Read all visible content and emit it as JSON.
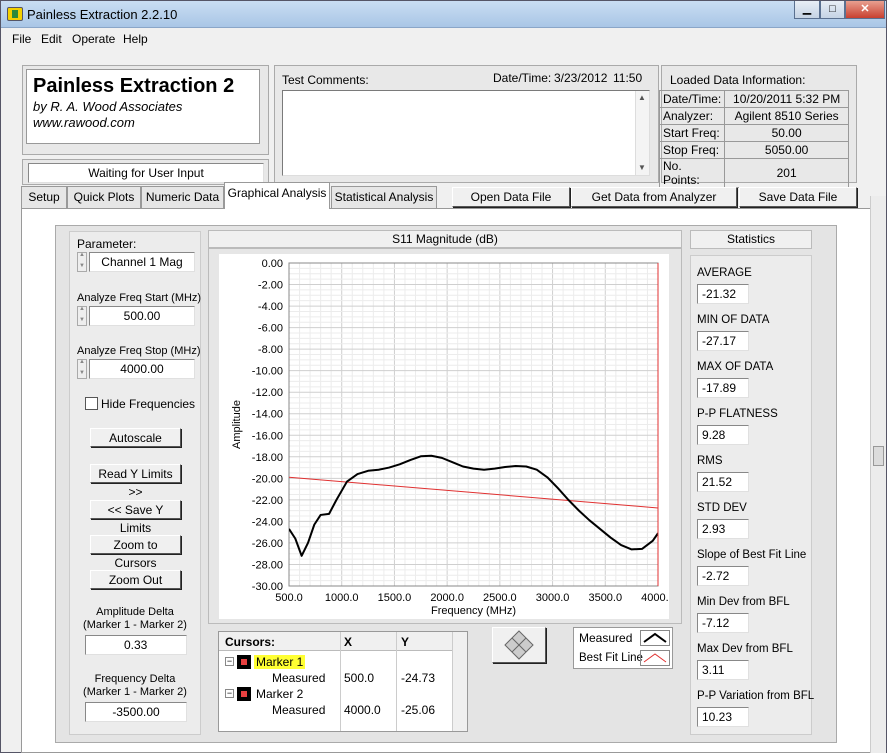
{
  "window": {
    "title": "Painless Extraction 2.2.10"
  },
  "menu": [
    "File",
    "Edit",
    "Operate",
    "Help"
  ],
  "brand": {
    "title": "Painless Extraction 2",
    "author": "by R. A. Wood Associates",
    "url": "www.rawood.com"
  },
  "status": "Waiting for User Input",
  "comments": {
    "label": "Test Comments:",
    "datetime_label": "Date/Time:",
    "date": "3/23/2012",
    "time": "11:50"
  },
  "loaded": {
    "heading": "Loaded Data Information:",
    "rows": [
      {
        "k": "Date/Time:",
        "v": "10/20/2011 5:32 PM"
      },
      {
        "k": "Analyzer:",
        "v": "Agilent 8510 Series"
      },
      {
        "k": "Start Freq:",
        "v": "50.00"
      },
      {
        "k": "Stop Freq:",
        "v": "5050.00"
      },
      {
        "k": "No. Points:",
        "v": "201"
      }
    ]
  },
  "tabs": [
    "Setup",
    "Quick Plots",
    "Numeric Data",
    "Graphical Analysis",
    "Statistical Analysis"
  ],
  "file_buttons": [
    "Open Data File",
    "Get Data from Analyzer",
    "Save Data File"
  ],
  "controls": {
    "parameter_label": "Parameter:",
    "parameter_value": "Channel 1 Mag",
    "start_label": "Analyze Freq Start (MHz)",
    "start_value": "500.00",
    "stop_label": "Analyze Freq Stop (MHz)",
    "stop_value": "4000.00",
    "hide_freq": "Hide Frequencies",
    "buttons": [
      "Autoscale",
      "Read Y Limits >>",
      "<< Save Y Limits",
      "Zoom to Cursors",
      "Zoom Out"
    ],
    "amp_delta_label1": "Amplitude Delta",
    "amp_delta_label2": "(Marker 1 - Marker 2)",
    "amp_delta": "0.33",
    "freq_delta_label1": "Frequency Delta",
    "freq_delta_label2": "(Marker 1 - Marker 2)",
    "freq_delta": "-3500.00"
  },
  "cursors": {
    "headers": [
      "Cursors:",
      "X",
      "Y"
    ],
    "rows": [
      {
        "name": "Marker 1",
        "sub": "Measured",
        "x": "500.0",
        "y": "-24.73"
      },
      {
        "name": "Marker 2",
        "sub": "Measured",
        "x": "4000.0",
        "y": "-25.06"
      }
    ]
  },
  "legend": [
    "Measured",
    "Best Fit Line"
  ],
  "statistics": {
    "heading": "Statistics",
    "items": [
      {
        "label": "AVERAGE",
        "value": "-21.32"
      },
      {
        "label": "MIN OF DATA",
        "value": "-27.17"
      },
      {
        "label": "MAX OF DATA",
        "value": "-17.89"
      },
      {
        "label": "P-P FLATNESS",
        "value": "9.28"
      },
      {
        "label": "RMS",
        "value": "21.52"
      },
      {
        "label": "STD DEV",
        "value": "2.93"
      },
      {
        "label": "Slope of Best Fit Line",
        "value": "-2.72"
      },
      {
        "label": "Min Dev from BFL",
        "value": "-7.12"
      },
      {
        "label": "Max Dev from BFL",
        "value": "3.11"
      },
      {
        "label": "P-P Variation from BFL",
        "value": "10.23"
      }
    ]
  },
  "chart_data": {
    "type": "line",
    "title": "S11 Magnitude (dB)",
    "xlabel": "Frequency (MHz)",
    "ylabel": "Amplitude",
    "xlim": [
      500,
      4000
    ],
    "ylim": [
      -30,
      0
    ],
    "xticks": [
      "500.0",
      "1000.0",
      "1500.0",
      "2000.0",
      "2500.0",
      "3000.0",
      "3500.0",
      "4000.0"
    ],
    "yticks": [
      "0.00",
      "-2.00",
      "-4.00",
      "-6.00",
      "-8.00",
      "-10.00",
      "-12.00",
      "-14.00",
      "-16.00",
      "-18.00",
      "-20.00",
      "-22.00",
      "-24.00",
      "-26.00",
      "-28.00",
      "-30.00"
    ],
    "grid": true,
    "series": [
      {
        "name": "Measured",
        "color": "#000000",
        "x": [
          500,
          560,
          620,
          680,
          740,
          800,
          880,
          950,
          1050,
          1150,
          1250,
          1350,
          1450,
          1550,
          1650,
          1750,
          1850,
          1950,
          2050,
          2150,
          2250,
          2350,
          2450,
          2550,
          2650,
          2750,
          2850,
          2950,
          3050,
          3150,
          3250,
          3350,
          3450,
          3550,
          3650,
          3750,
          3850,
          3950,
          4000
        ],
        "y": [
          -24.7,
          -25.6,
          -27.2,
          -26.0,
          -24.3,
          -23.4,
          -23.3,
          -22.0,
          -20.3,
          -19.6,
          -19.3,
          -19.2,
          -19.0,
          -18.7,
          -18.3,
          -17.95,
          -17.9,
          -18.1,
          -18.5,
          -18.9,
          -19.1,
          -19.2,
          -19.1,
          -18.95,
          -18.85,
          -18.9,
          -19.2,
          -19.9,
          -20.9,
          -22.0,
          -23.0,
          -23.9,
          -24.7,
          -25.5,
          -26.2,
          -26.6,
          -26.55,
          -25.8,
          -25.1
        ]
      },
      {
        "name": "Best Fit Line",
        "color": "#e03030",
        "x": [
          500,
          4000
        ],
        "y": [
          -19.9,
          -22.75
        ]
      }
    ]
  }
}
